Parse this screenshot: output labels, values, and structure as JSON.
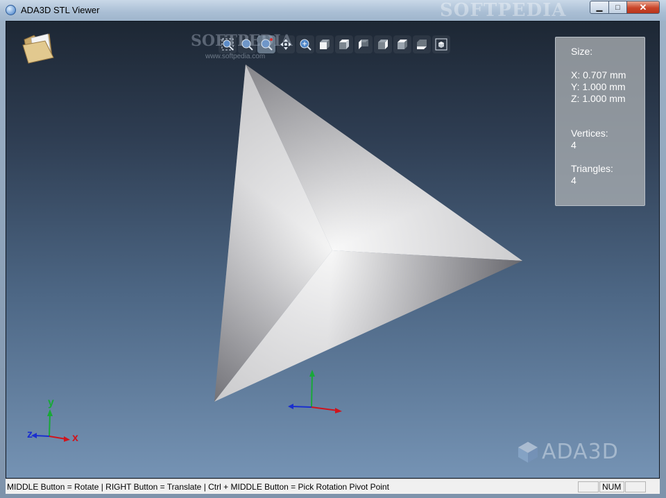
{
  "window": {
    "title": "ADA3D STL Viewer",
    "watermark": "SOFTPEDIA"
  },
  "controls": {
    "minimize": "▁",
    "maximize": "□",
    "close": "✕"
  },
  "viewport": {
    "watermark_text": "SOFTPEDIA",
    "watermark_url": "www.softpedia.com",
    "toolbar_icons": [
      "zoom-fit-icon",
      "zoom-window-icon",
      "zoom-pick-icon",
      "pan-icon",
      "zoom-icon",
      "view-front-icon",
      "view-back-icon",
      "view-left-icon",
      "view-right-icon",
      "view-top-icon",
      "view-bottom-icon",
      "view-iso-icon"
    ],
    "logo_text": "ADA3D"
  },
  "info": {
    "size_label": "Size:",
    "x": "X: 0.707 mm",
    "y": "Y: 1.000 mm",
    "z": "Z: 1.000 mm",
    "vertices_label": "Vertices:",
    "vertices_value": "4",
    "triangles_label": "Triangles:",
    "triangles_value": "4"
  },
  "axes_labels": {
    "x": "x",
    "y": "y",
    "z": "z"
  },
  "status": {
    "hint": "MIDDLE Button = Rotate | RIGHT Button = Translate | Ctrl + MIDDLE Button = Pick Rotation Pivot Point",
    "pane1": "",
    "num": "NUM",
    "pane3": ""
  },
  "colors": {
    "axis_x": "#d0141c",
    "axis_y": "#18a838",
    "axis_z": "#1a2fcf"
  }
}
